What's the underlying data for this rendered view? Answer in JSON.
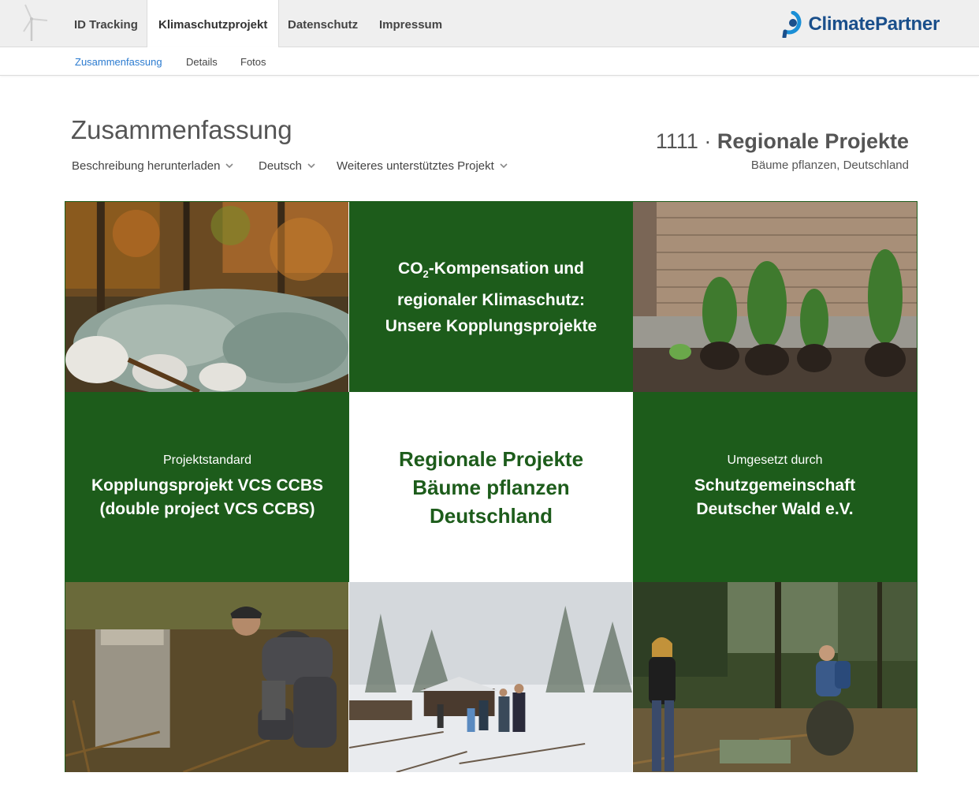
{
  "topnav": {
    "tabs": [
      {
        "label": "ID Tracking"
      },
      {
        "label": "Klimaschutzprojekt"
      },
      {
        "label": "Datenschutz"
      },
      {
        "label": "Impressum"
      }
    ],
    "brand": "ClimatePartner"
  },
  "subnav": {
    "tabs": [
      {
        "label": "Zusammenfassung"
      },
      {
        "label": "Details"
      },
      {
        "label": "Fotos"
      }
    ]
  },
  "page": {
    "title": "Zusammenfassung",
    "dropdowns": [
      {
        "label": "Beschreibung herunterladen"
      },
      {
        "label": "Deutsch"
      },
      {
        "label": "Weiteres unterstütztes Projekt"
      }
    ]
  },
  "project": {
    "id": "1111",
    "separator": "·",
    "name": "Regionale Projekte",
    "subtitle": "Bäume pflanzen, Deutschland"
  },
  "tiles": {
    "hero": {
      "line1_prefix": "CO",
      "line1_sub": "2",
      "line1_suffix": "-Kompensation und",
      "line2": "regionaler Klimaschutz:",
      "line3": "Unsere Kopplungsprojekte"
    },
    "standard": {
      "label": "Projektstandard",
      "line1": "Kopplungsprojekt VCS CCBS",
      "line2": "(double project VCS CCBS)"
    },
    "center": {
      "line1": "Regionale Projekte",
      "line2": "Bäume pflanzen",
      "line3": "Deutschland"
    },
    "implementer": {
      "label": "Umgesetzt durch",
      "line1": "Schutzgemeinschaft",
      "line2": "Deutscher Wald e.V."
    }
  },
  "colors": {
    "green": "#1d5c1b",
    "link_blue": "#2b7bd0",
    "brand_blue": "#1a4f8b"
  }
}
